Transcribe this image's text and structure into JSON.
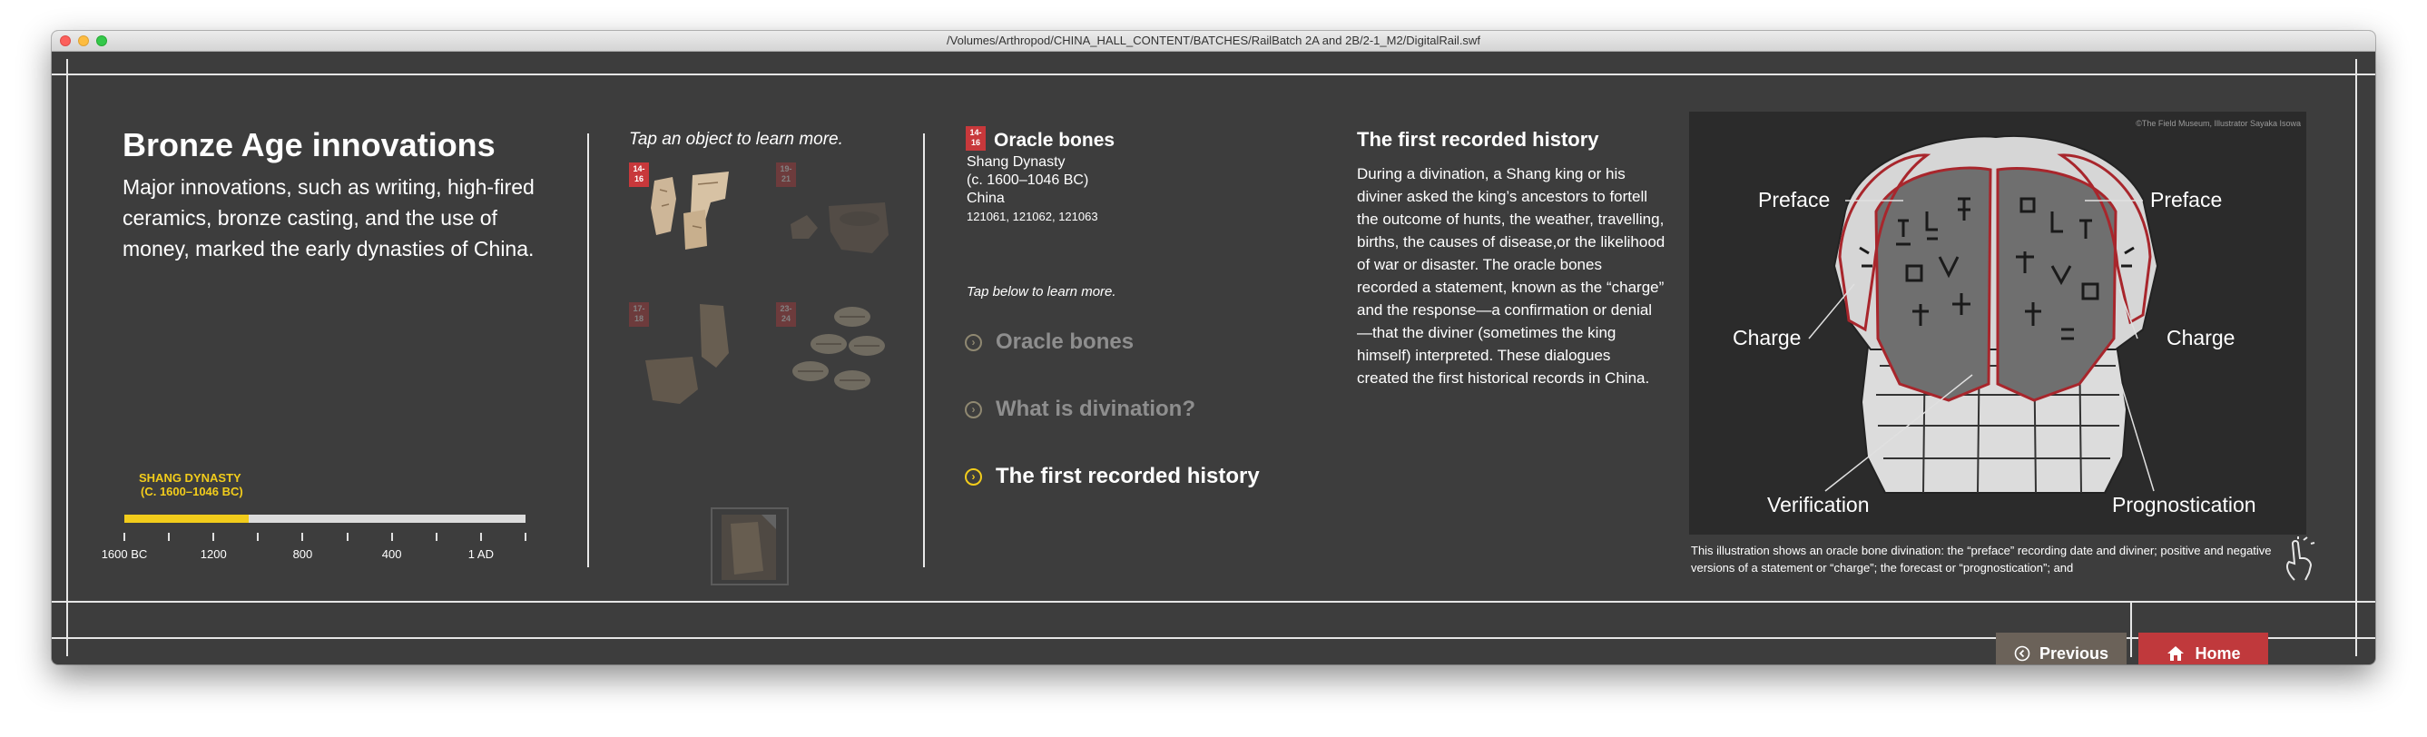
{
  "window": {
    "title": "/Volumes/Arthropod/CHINA_HALL_CONTENT/BATCHES/RailBatch 2A and 2B/2-1_M2/DigitalRail.swf"
  },
  "intro": {
    "title": "Bronze Age innovations",
    "description": "Major innovations, such as writing, high-fired ceramics, bronze casting, and the use of money, marked the early dynasties of China."
  },
  "timeline": {
    "dynasty_line1": "SHANG DYNASTY",
    "dynasty_line2": "(C. 1600–1046 BC)",
    "highlight_fraction": 0.31,
    "highlight_color": "#f2cc1b",
    "ticks": [
      "1600 BC",
      "1200",
      "800",
      "400",
      "1 AD"
    ]
  },
  "objects": {
    "prompt": "Tap an object to learn more.",
    "groups": [
      {
        "badge": "14-\n16",
        "active": true
      },
      {
        "badge": "19-\n21",
        "active": false
      },
      {
        "badge": "17-\n18",
        "active": false
      },
      {
        "badge": "23-\n24",
        "active": false
      }
    ]
  },
  "detail": {
    "badge": "14-\n16",
    "title": "Oracle bones",
    "dynasty": "Shang Dynasty",
    "date": "(c. 1600–1046 BC)",
    "place": "China",
    "catalog": "121061, 121062, 121063",
    "tap_prompt": "Tap below to learn more.",
    "nav": [
      {
        "label": "Oracle bones",
        "active": false
      },
      {
        "label": "What is divination?",
        "active": false
      },
      {
        "label": "The first recorded history",
        "active": true
      }
    ]
  },
  "article": {
    "title": "The first recorded history",
    "body": "During a divination, a Shang king or his diviner asked the king’s ancestors to fortell the outcome of hunts, the weather, travelling, births, the causes of disease,or the likelihood of war or disaster. The oracle bones recorded a statement, known as the “charge” and the response—a confirmation or denial—that the diviner (sometimes the king himself) interpreted. These dialogues created the first historical records in China."
  },
  "illustration": {
    "credit": "©The Field Museum, Illustrator Sayaka Isowa",
    "labels": {
      "preface_left": "Preface",
      "preface_right": "Preface",
      "charge_left": "Charge",
      "charge_right": "Charge",
      "verification": "Verification",
      "prognostication": "Prognostication"
    },
    "caption": "This illustration shows an oracle bone divination:  the “preface” recording date and diviner; positive and negative versions of a statement or “charge”; the forecast or “prognostication”; and"
  },
  "footer": {
    "previous_label": "Previous",
    "home_label": "Home",
    "previous_color": "#6b6259",
    "home_color": "#c0393c"
  }
}
